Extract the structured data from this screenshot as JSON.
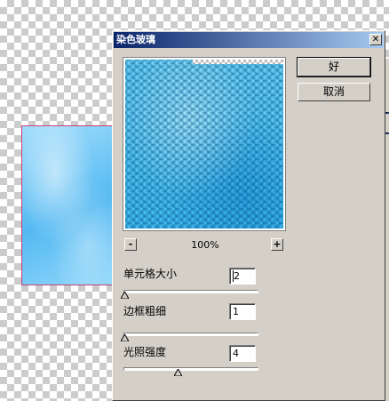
{
  "dialog": {
    "title": "染色玻璃",
    "close_glyph": "✕",
    "ok_label": "好",
    "cancel_label": "取消"
  },
  "preview": {
    "zoom_out": "-",
    "zoom_in": "+",
    "zoom_level": "100%"
  },
  "params": {
    "cell_size": {
      "label": "单元格大小",
      "value": "2",
      "slider_fraction": 0.0
    },
    "border_thickness": {
      "label": "边框粗细",
      "value": "1",
      "slider_fraction": 0.0
    },
    "light_intensity": {
      "label": "光照强度",
      "value": "4",
      "slider_fraction": 0.4
    }
  },
  "colors": {
    "titlebar_start": "#0a246a",
    "titlebar_end": "#a6caf0",
    "dialog_face": "#d4d0c8",
    "canvas_border": "#c8407a"
  }
}
